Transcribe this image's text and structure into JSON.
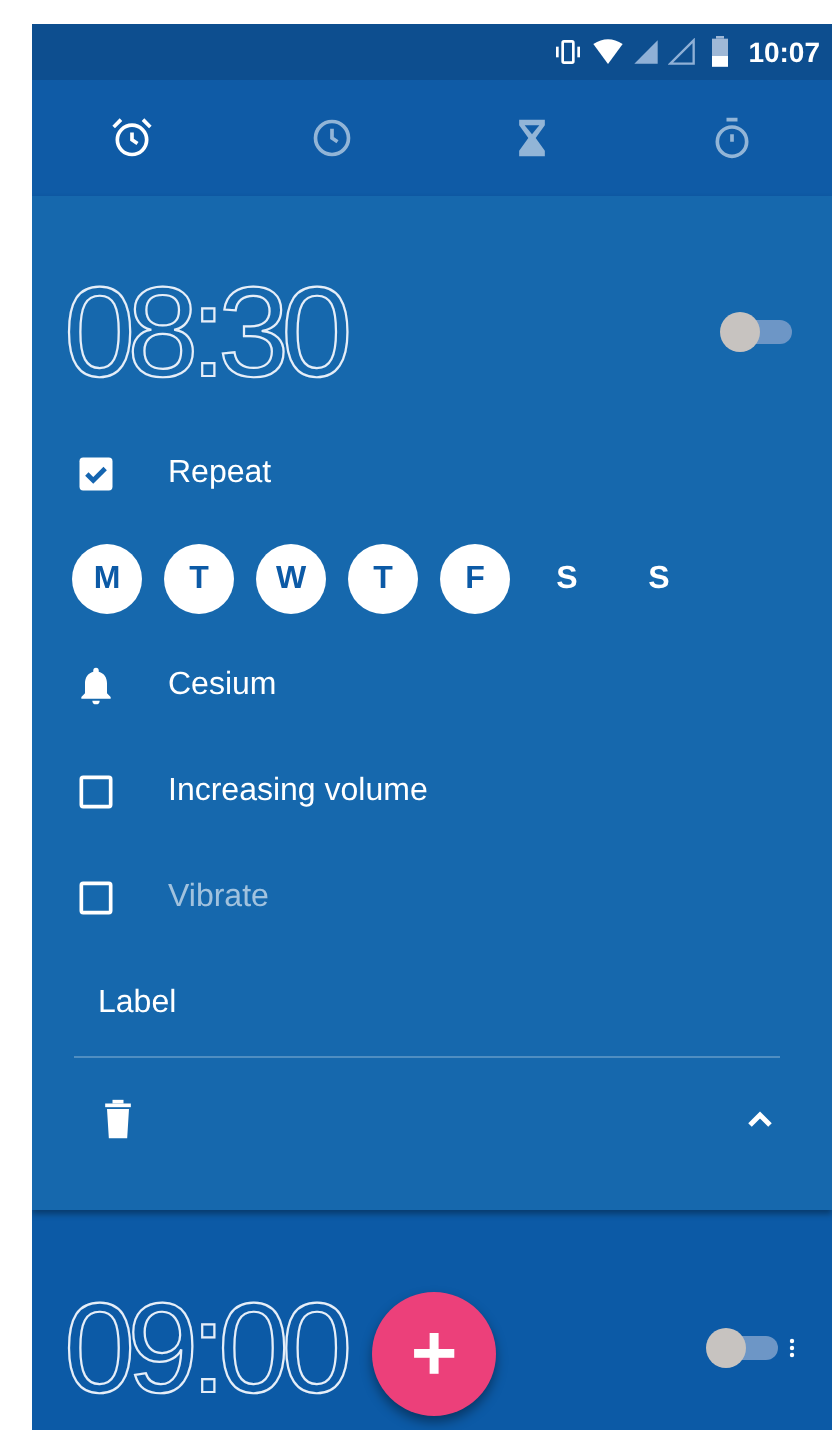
{
  "status_bar": {
    "time": "10:07"
  },
  "tabs": [
    {
      "kind": "alarm",
      "selected": true
    },
    {
      "kind": "clock",
      "selected": false
    },
    {
      "kind": "timer",
      "selected": false
    },
    {
      "kind": "stopwatch",
      "selected": false
    }
  ],
  "alarms": [
    {
      "time": "08:30",
      "on": false,
      "expanded": true,
      "options": [
        {
          "kind": "checkbox",
          "text": "Repeat",
          "checked": true,
          "disabled": false
        },
        {
          "kind": "days",
          "days": [
            {
              "letter": "M",
              "selected": true
            },
            {
              "letter": "T",
              "selected": true
            },
            {
              "letter": "W",
              "selected": true
            },
            {
              "letter": "T",
              "selected": true
            },
            {
              "letter": "F",
              "selected": true
            },
            {
              "letter": "S",
              "selected": false
            },
            {
              "letter": "S",
              "selected": false
            }
          ]
        },
        {
          "kind": "ringtone",
          "text": "Cesium"
        },
        {
          "kind": "checkbox",
          "text": "Increasing volume",
          "checked": false,
          "disabled": false
        },
        {
          "kind": "checkbox",
          "text": "Vibrate",
          "checked": false,
          "disabled": true
        },
        {
          "kind": "label",
          "text": "Label"
        }
      ]
    },
    {
      "time": "09:00",
      "on": false,
      "expanded": false
    }
  ],
  "fab": {
    "text": "+"
  }
}
